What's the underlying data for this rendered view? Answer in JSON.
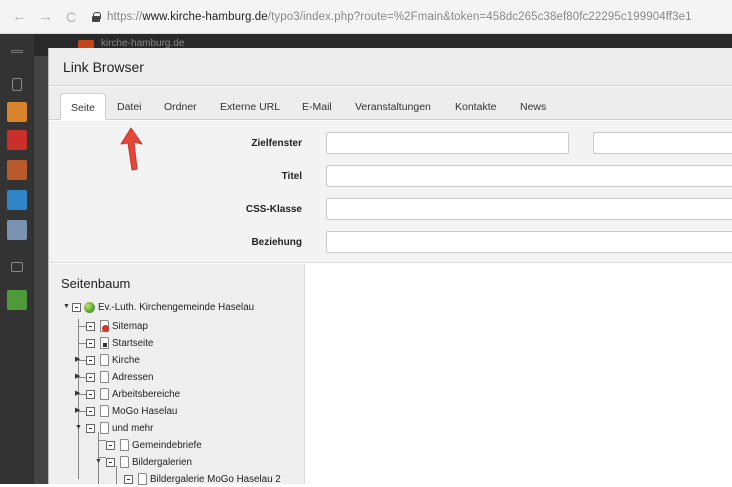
{
  "browser": {
    "back_icon": "←",
    "forward_icon": "→",
    "reload_icon": "C",
    "url_prefix": "https://",
    "url_domain": "www.kirche-hamburg.de",
    "url_path": "/typo3/index.php?route=%2Fmain&token=458dc265c38ef80fc22295c199904ff3e1"
  },
  "backend": {
    "site_name": "kirche-hamburg.de"
  },
  "modal": {
    "title": "Link Browser",
    "tabs": [
      {
        "label": "Seite",
        "active": true
      },
      {
        "label": "Datei",
        "active": false
      },
      {
        "label": "Ordner",
        "active": false
      },
      {
        "label": "Externe URL",
        "active": false
      },
      {
        "label": "E-Mail",
        "active": false
      },
      {
        "label": "Veranstaltungen",
        "active": false
      },
      {
        "label": "Kontakte",
        "active": false
      },
      {
        "label": "News",
        "active": false
      }
    ],
    "form": {
      "target_label": "Zielfenster",
      "target_value": "",
      "target_select_value": "",
      "title_label": "Titel",
      "title_value": "",
      "css_label": "CSS-Klasse",
      "css_value": "",
      "relation_label": "Beziehung",
      "relation_value": ""
    },
    "tree": {
      "title": "Seitenbaum",
      "items": [
        {
          "label": "Ev.-Luth. Kirchengemeinde Haselau",
          "icon": "globe-icon"
        },
        {
          "label": "Sitemap",
          "icon": "sitemap-page-icon"
        },
        {
          "label": "Startseite",
          "icon": "startpage-icon"
        },
        {
          "label": "Kirche",
          "icon": "page-icon"
        },
        {
          "label": "Adressen",
          "icon": "page-icon"
        },
        {
          "label": "Arbeitsbereiche",
          "icon": "page-icon"
        },
        {
          "label": "MoGo Haselau",
          "icon": "page-icon"
        },
        {
          "label": "und mehr",
          "icon": "page-icon"
        },
        {
          "label": "Gemeindebriefe",
          "icon": "page-icon"
        },
        {
          "label": "Bildergalerien",
          "icon": "page-icon"
        },
        {
          "label": "Bildergalerie MoGo Haselau 2",
          "icon": "page-icon"
        }
      ]
    }
  },
  "colors": {
    "annotation_arrow": "#e2473a",
    "typo3_orange": "#c4441b"
  }
}
